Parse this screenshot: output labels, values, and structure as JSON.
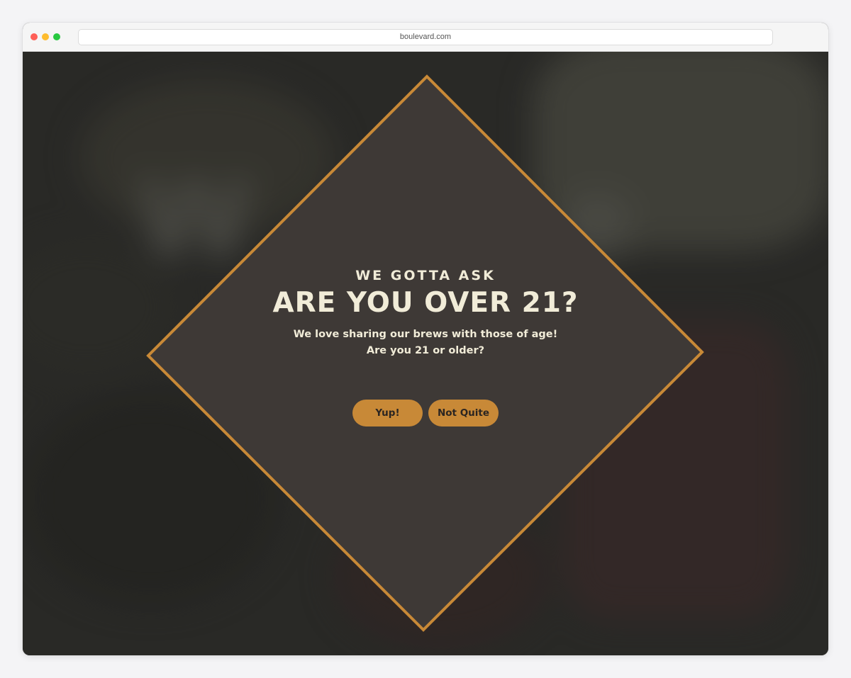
{
  "browser": {
    "url": "boulevard.com"
  },
  "background": {
    "blurred_word_left": "W",
    "blurred_word_right": "e"
  },
  "age_gate": {
    "kicker": "WE GOTTA ASK",
    "headline": "ARE YOU OVER 21?",
    "body": "We love sharing our brews with those of age!  Are you 21 or older?",
    "confirm_label": "Yup!",
    "deny_label": "Not Quite"
  },
  "colors": {
    "accent": "#c88937",
    "panel": "#3e3936",
    "text": "#f1ecd8",
    "button_text": "#2b2521"
  }
}
